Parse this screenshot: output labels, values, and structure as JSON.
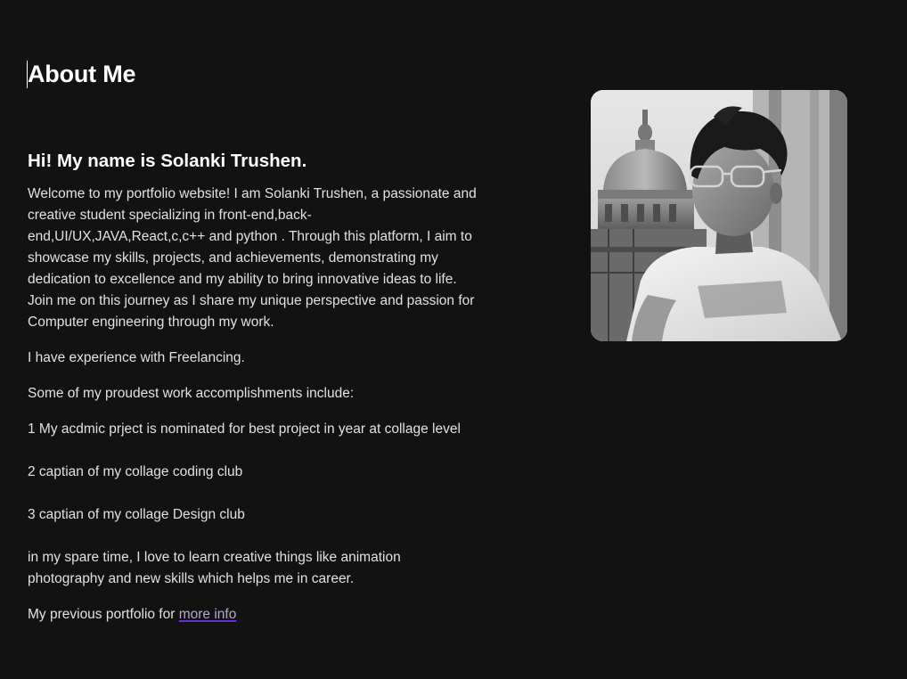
{
  "about": {
    "title": "About Me",
    "greeting": "Hi! My name is Solanki Trushen.",
    "bio": "Welcome to my portfolio website! I am Solanki Trushen, a passionate and creative student specializing in front-end,back-end,UI/UX,JAVA,React,c,c++ and python . Through this platform, I aim to showcase my skills, projects, and achievements, demonstrating my dedication to excellence and my ability to bring innovative ideas to life. Join me on this journey as I share my unique perspective and passion for Computer engineering through my work.",
    "experience": "I have experience with Freelancing.",
    "accomplishments_intro": "Some of my proudest work accomplishments include:",
    "accomplishments": [
      "1 My acdmic prject is nominated for best project in year at collage level",
      "2 captian of my collage coding club",
      "3 captian of my collage Design club"
    ],
    "spare_time": "in my spare time, I love to learn creative things like animation photography and new skills which helps me in career.",
    "previous_portfolio_prefix": "My previous portfolio for",
    "previous_portfolio_link": "more info"
  },
  "colors": {
    "background": "#121212",
    "text": "#e2e2e2",
    "heading": "#ffffff",
    "link_underline": "#6d2bd9"
  }
}
